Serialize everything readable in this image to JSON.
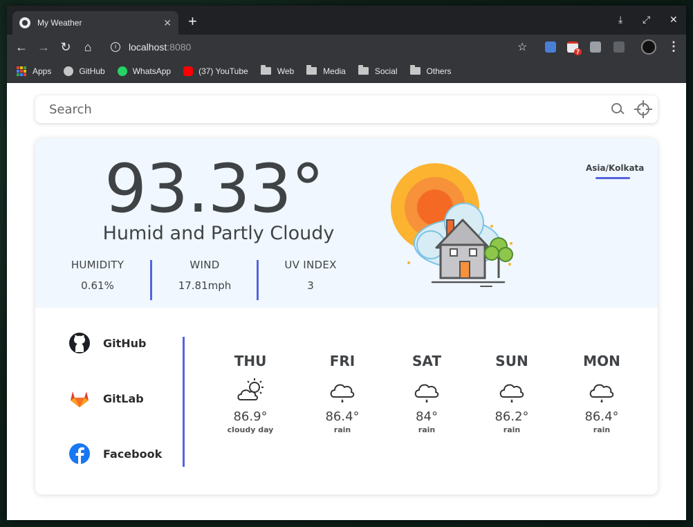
{
  "browser": {
    "tab_title": "My Weather",
    "tab_close": "✕",
    "new_tab": "+",
    "url_host": "localhost",
    "url_port": ":8080",
    "mail_badge": "7",
    "window_controls": {
      "minimize": "⤓",
      "maximize": "⤢",
      "close": "✕"
    },
    "bookmarks": [
      {
        "label": "Apps",
        "icon": "apps-grid-icon"
      },
      {
        "label": "GitHub",
        "icon": "github-icon"
      },
      {
        "label": "WhatsApp",
        "icon": "whatsapp-icon"
      },
      {
        "label": "(37) YouTube",
        "icon": "youtube-icon"
      },
      {
        "label": "Web",
        "icon": "folder-icon"
      },
      {
        "label": "Media",
        "icon": "folder-icon"
      },
      {
        "label": "Social",
        "icon": "folder-icon"
      },
      {
        "label": "Others",
        "icon": "folder-icon"
      }
    ]
  },
  "search": {
    "placeholder": "Search"
  },
  "current": {
    "temperature": "93.33°",
    "condition": "Humid and Partly Cloudy",
    "timezone": "Asia/Kolkata",
    "stats": [
      {
        "label": "HUMIDITY",
        "value": "0.61%"
      },
      {
        "label": "WIND",
        "value": "17.81mph"
      },
      {
        "label": "UV INDEX",
        "value": "3"
      }
    ]
  },
  "social": [
    {
      "label": "GitHub",
      "icon": "github-icon"
    },
    {
      "label": "GitLab",
      "icon": "gitlab-icon"
    },
    {
      "label": "Facebook",
      "icon": "facebook-icon"
    }
  ],
  "forecast": [
    {
      "day": "THU",
      "temp": "86.9°",
      "desc": "cloudy day",
      "icon": "cloudy-day-icon"
    },
    {
      "day": "FRI",
      "temp": "86.4°",
      "desc": "rain",
      "icon": "rain-cloud-icon"
    },
    {
      "day": "SAT",
      "temp": "84°",
      "desc": "rain",
      "icon": "rain-cloud-icon"
    },
    {
      "day": "SUN",
      "temp": "86.2°",
      "desc": "rain",
      "icon": "rain-cloud-icon"
    },
    {
      "day": "MON",
      "temp": "86.4°",
      "desc": "rain",
      "icon": "rain-cloud-icon"
    }
  ],
  "colors": {
    "accent": "#5563de",
    "panel": "#f0f7fe",
    "text": "#404346"
  }
}
